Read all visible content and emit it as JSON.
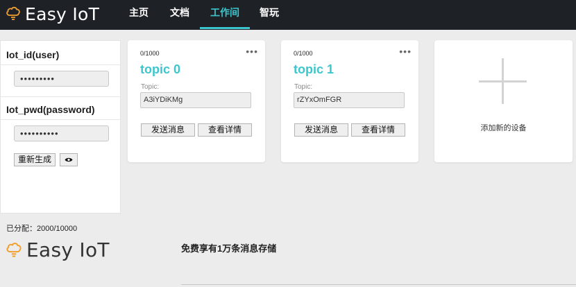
{
  "header": {
    "brand": "Easy IoT",
    "nav": [
      "主页",
      "文档",
      "工作间",
      "智玩"
    ],
    "active_nav": "工作间"
  },
  "credentials": {
    "iot_id_label": "Iot_id(user)",
    "iot_id_value": "•••••••••",
    "iot_pwd_label": "Iot_pwd(password)",
    "iot_pwd_value": "••••••••••",
    "regenerate_label": "重新生成",
    "show_icon": "eye-icon",
    "allocated": "已分配：2000/10000"
  },
  "topics": [
    {
      "count": "0/1000",
      "name": "topic 0",
      "topic_label": "Topic:",
      "topic_id": "A3iYDiKMg",
      "send_label": "发送消息",
      "detail_label": "查看详情"
    },
    {
      "count": "0/1000",
      "name": "topic 1",
      "topic_label": "Topic:",
      "topic_id": "rZYxOmFGR",
      "send_label": "发送消息",
      "detail_label": "查看详情"
    }
  ],
  "add_device": {
    "label": "添加新的设备"
  },
  "footer": {
    "brand": "Easy IoT",
    "slogan": "免费享有1万条消息存储"
  },
  "colors": {
    "accent": "#3cc6cd",
    "topbar": "#1e2227",
    "logo": "#f0a030"
  }
}
